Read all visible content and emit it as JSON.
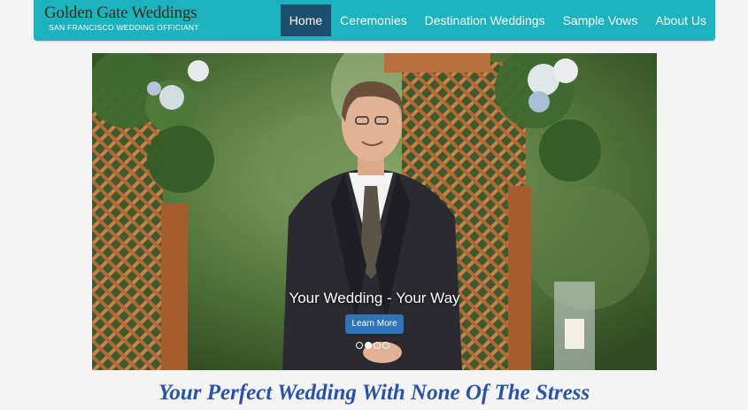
{
  "brand": {
    "name": "Golden Gate Weddings",
    "subtitle": "SAN FRANCISCO WEDDING OFFICIANT"
  },
  "nav": {
    "items": [
      {
        "label": "Home",
        "active": true
      },
      {
        "label": "Ceremonies",
        "active": false
      },
      {
        "label": "Destination Weddings",
        "active": false
      },
      {
        "label": "Sample Vows",
        "active": false
      },
      {
        "label": "About Us",
        "active": false
      }
    ]
  },
  "hero": {
    "caption": "Your Wedding - Your Way",
    "button_label": "Learn More",
    "slide_count": 4,
    "active_slide": 2
  },
  "tagline": "Your Perfect Wedding With None Of The Stress",
  "colors": {
    "navbar": "#1bb3bd",
    "nav_active": "#1e4e6e",
    "button": "#2e73b5",
    "tagline": "#2a53a8"
  }
}
